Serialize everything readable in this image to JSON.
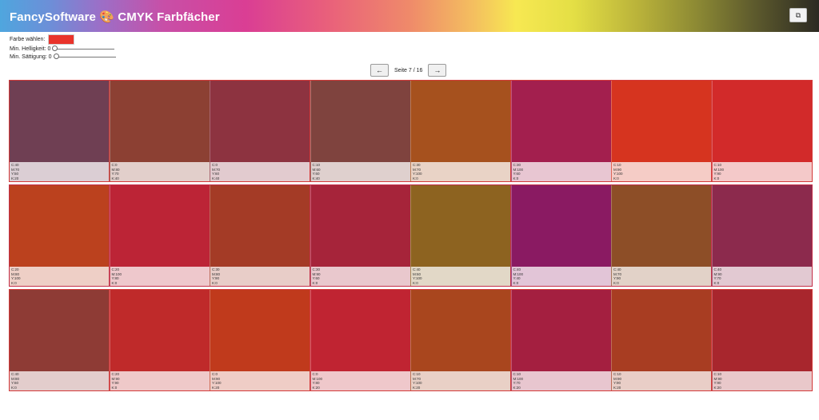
{
  "header": {
    "title": "FancySoftware 🎨 CMYK Farbfächer",
    "action_icon": "copy-window-icon"
  },
  "controls": {
    "color_label": "Farbe wählen:",
    "color_value": "#e9342b",
    "brightness_label": "Min. Helligkeit: 0",
    "brightness_value": 0,
    "saturation_label": "Min. Sättigung: 0",
    "saturation_value": 0
  },
  "pager": {
    "prev_icon": "←",
    "next_icon": "→",
    "label": "Seite 7 / 16"
  },
  "rows": [
    {
      "border": "#d33a3a",
      "swatches": [
        {
          "color": "#6f3f53",
          "c": "C:40",
          "m": "M:70",
          "y": "Y:50",
          "k": "K:20"
        },
        {
          "color": "#8c4033",
          "c": "C:0",
          "m": "M:80",
          "y": "Y:70",
          "k": "K:40"
        },
        {
          "color": "#8d3340",
          "c": "C:0",
          "m": "M:70",
          "y": "Y:60",
          "k": "K:40"
        },
        {
          "color": "#7f433e",
          "c": "C:10",
          "m": "M:60",
          "y": "Y:60",
          "k": "K:40"
        },
        {
          "color": "#a6511e",
          "c": "C:30",
          "m": "M:70",
          "y": "Y:100",
          "k": "K:0"
        },
        {
          "color": "#a31f4e",
          "c": "C:30",
          "m": "M:100",
          "y": "Y:60",
          "k": "K:0"
        },
        {
          "color": "#d6341f",
          "c": "C:10",
          "m": "M:90",
          "y": "Y:100",
          "k": "K:0"
        },
        {
          "color": "#d22a2a",
          "c": "C:10",
          "m": "M:100",
          "y": "Y:90",
          "k": "K:0"
        }
      ]
    },
    {
      "border": "#c4304a",
      "swatches": [
        {
          "color": "#bb411e",
          "c": "C:20",
          "m": "M:80",
          "y": "Y:100",
          "k": "K:0"
        },
        {
          "color": "#bc2436",
          "c": "C:20",
          "m": "M:100",
          "y": "Y:80",
          "k": "K:0"
        },
        {
          "color": "#a43b26",
          "c": "C:30",
          "m": "M:80",
          "y": "Y:90",
          "k": "K:0"
        },
        {
          "color": "#a6243a",
          "c": "C:30",
          "m": "M:90",
          "y": "Y:60",
          "k": "K:0"
        },
        {
          "color": "#8d6320",
          "c": "C:40",
          "m": "M:60",
          "y": "Y:100",
          "k": "K:0"
        },
        {
          "color": "#8a1a62",
          "c": "C:40",
          "m": "M:100",
          "y": "Y:40",
          "k": "K:0"
        },
        {
          "color": "#8d4e27",
          "c": "C:40",
          "m": "M:70",
          "y": "Y:90",
          "k": "K:0"
        },
        {
          "color": "#8c2a4d",
          "c": "C:40",
          "m": "M:90",
          "y": "Y:70",
          "k": "K:0"
        }
      ]
    },
    {
      "border": "#d33a3a",
      "swatches": [
        {
          "color": "#8e3b35",
          "c": "C:40",
          "m": "M:80",
          "y": "Y:60",
          "k": "K:0"
        },
        {
          "color": "#bf2a2a",
          "c": "C:20",
          "m": "M:90",
          "y": "Y:90",
          "k": "K:0"
        },
        {
          "color": "#c03a1c",
          "c": "C:0",
          "m": "M:90",
          "y": "Y:100",
          "k": "K:20"
        },
        {
          "color": "#c02432",
          "c": "C:0",
          "m": "M:100",
          "y": "Y:80",
          "k": "K:20"
        },
        {
          "color": "#a9461e",
          "c": "C:10",
          "m": "M:70",
          "y": "Y:100",
          "k": "K:20"
        },
        {
          "color": "#a41f40",
          "c": "C:10",
          "m": "M:100",
          "y": "Y:70",
          "k": "K:20"
        },
        {
          "color": "#a83d22",
          "c": "C:10",
          "m": "M:90",
          "y": "Y:90",
          "k": "K:20"
        },
        {
          "color": "#a8262d",
          "c": "C:10",
          "m": "M:90",
          "y": "Y:90",
          "k": "K:20"
        }
      ]
    }
  ]
}
